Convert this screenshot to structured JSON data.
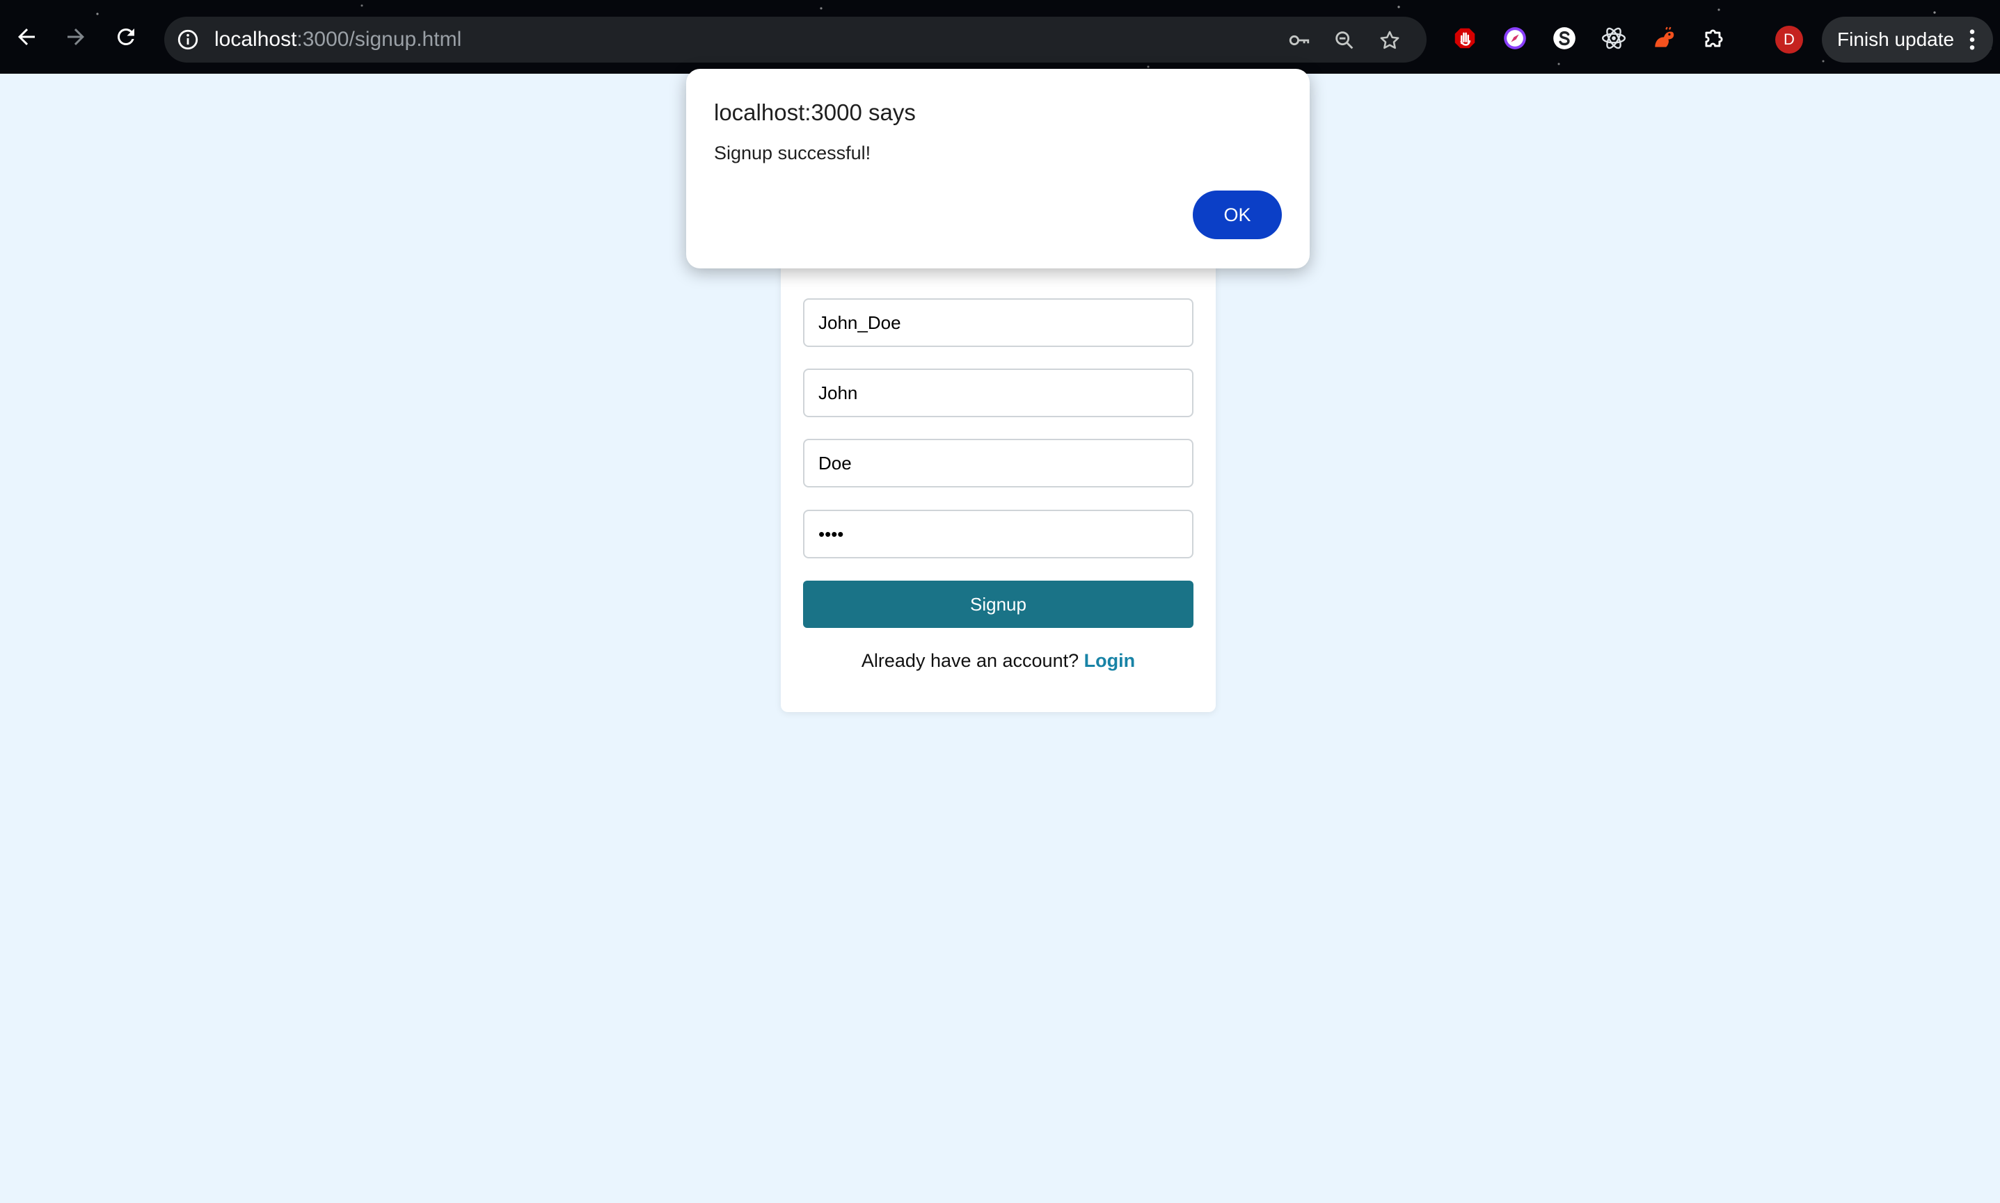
{
  "browser": {
    "url_host": "localhost",
    "url_path": ":3000/signup.html",
    "update_button_label": "Finish update",
    "profile_initial": "D",
    "icons": {
      "back": "arrow-left-icon",
      "forward": "arrow-right-icon",
      "reload": "reload-icon",
      "site_info": "info-icon",
      "passwords": "key-icon",
      "zoom": "zoom-out-icon",
      "bookmark": "star-icon",
      "extensions": [
        "hand-stop-icon",
        "compass-icon",
        "s-logo-icon",
        "atom-icon",
        "squirrel-icon",
        "puzzle-icon"
      ],
      "menu": "kebab-menu-icon"
    },
    "colors": {
      "toolbar": "#05070c",
      "omnibox": "#1f2226",
      "avatar": "#c5221f"
    }
  },
  "form": {
    "username": "John_Doe",
    "first_name": "John",
    "last_name": "Doe",
    "password": "mypw",
    "signup_label": "Signup",
    "login_prompt": "Already have an account?",
    "login_link": "Login",
    "colors": {
      "button": "#1a7387",
      "link": "#1883a6",
      "page_background": "#eaf5fe"
    }
  },
  "dialog": {
    "title": "localhost:3000 says",
    "message": "Signup successful!",
    "ok_label": "OK",
    "colors": {
      "ok_button": "#0b3fc7"
    }
  }
}
